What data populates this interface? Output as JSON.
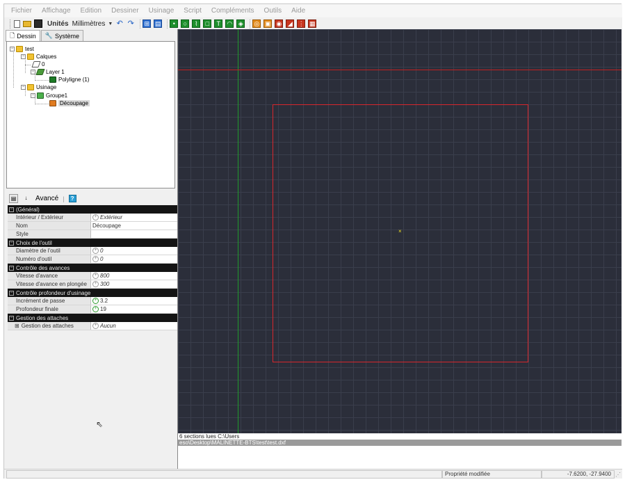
{
  "menu": [
    "Fichier",
    "Affichage",
    "Edition",
    "Dessiner",
    "Usinage",
    "Script",
    "Compléments",
    "Outils",
    "Aide"
  ],
  "toolbar": {
    "units_label": "Unités",
    "units_value": "Millimètres"
  },
  "tabs": [
    {
      "label": "Dessin"
    },
    {
      "label": "Système"
    }
  ],
  "tree": {
    "root": "test",
    "calques": "Calques",
    "layer0": "0",
    "layer1": "Layer 1",
    "polyline": "Polyligne (1)",
    "usinage": "Usinage",
    "groupe": "Groupe1",
    "decoupage": "Découpage"
  },
  "propgrid": {
    "mode_label": "Avancé",
    "help": "?",
    "sections": [
      {
        "title": "(Général)",
        "rows": [
          {
            "key": "Intérieur / Extérieur",
            "value": "Extérieur",
            "italic": true,
            "icon": "circle"
          },
          {
            "key": "Nom",
            "value": "Découpage",
            "italic": false,
            "icon": "none"
          },
          {
            "key": "Style",
            "value": "",
            "italic": false,
            "icon": "none"
          }
        ]
      },
      {
        "title": "Choix de l'outil",
        "rows": [
          {
            "key": "Diamètre de l'outil",
            "value": "0",
            "italic": true,
            "icon": "circle"
          },
          {
            "key": "Numéro d'outil",
            "value": "0",
            "italic": true,
            "icon": "circle"
          }
        ]
      },
      {
        "title": "Contrôle des avances",
        "rows": [
          {
            "key": "Vitesse d'avance",
            "value": "800",
            "italic": true,
            "icon": "circle"
          },
          {
            "key": "Vitesse d'avance en plongée",
            "value": "300",
            "italic": true,
            "icon": "circle"
          }
        ]
      },
      {
        "title": "Contrôle profondeur d'usinage",
        "rows": [
          {
            "key": "Incrément de passe",
            "value": "3.2",
            "italic": false,
            "icon": "green"
          },
          {
            "key": "Profondeur finale",
            "value": "19",
            "italic": false,
            "icon": "green"
          }
        ]
      },
      {
        "title": "Gestion des attaches",
        "rows": [
          {
            "key": "Gestion des attaches",
            "value": "Aucun",
            "italic": true,
            "icon": "circle",
            "expandable": true
          }
        ]
      }
    ]
  },
  "console": {
    "line1": "6 sections lues C:\\Users",
    "line2": "eso\\Desktop\\MALINETTE-BTS\\test\\test.dxf"
  },
  "status": {
    "message": "Propriété modifiée",
    "coords": "-7.6200, -27.9400"
  },
  "colors": {
    "canvas_bg": "#2b2e3a",
    "grid": "#3a3e4c",
    "axis_x": "#c42020",
    "axis_y": "#1f9a2b",
    "shape": "#d8262c",
    "category_bg": "#141414"
  }
}
